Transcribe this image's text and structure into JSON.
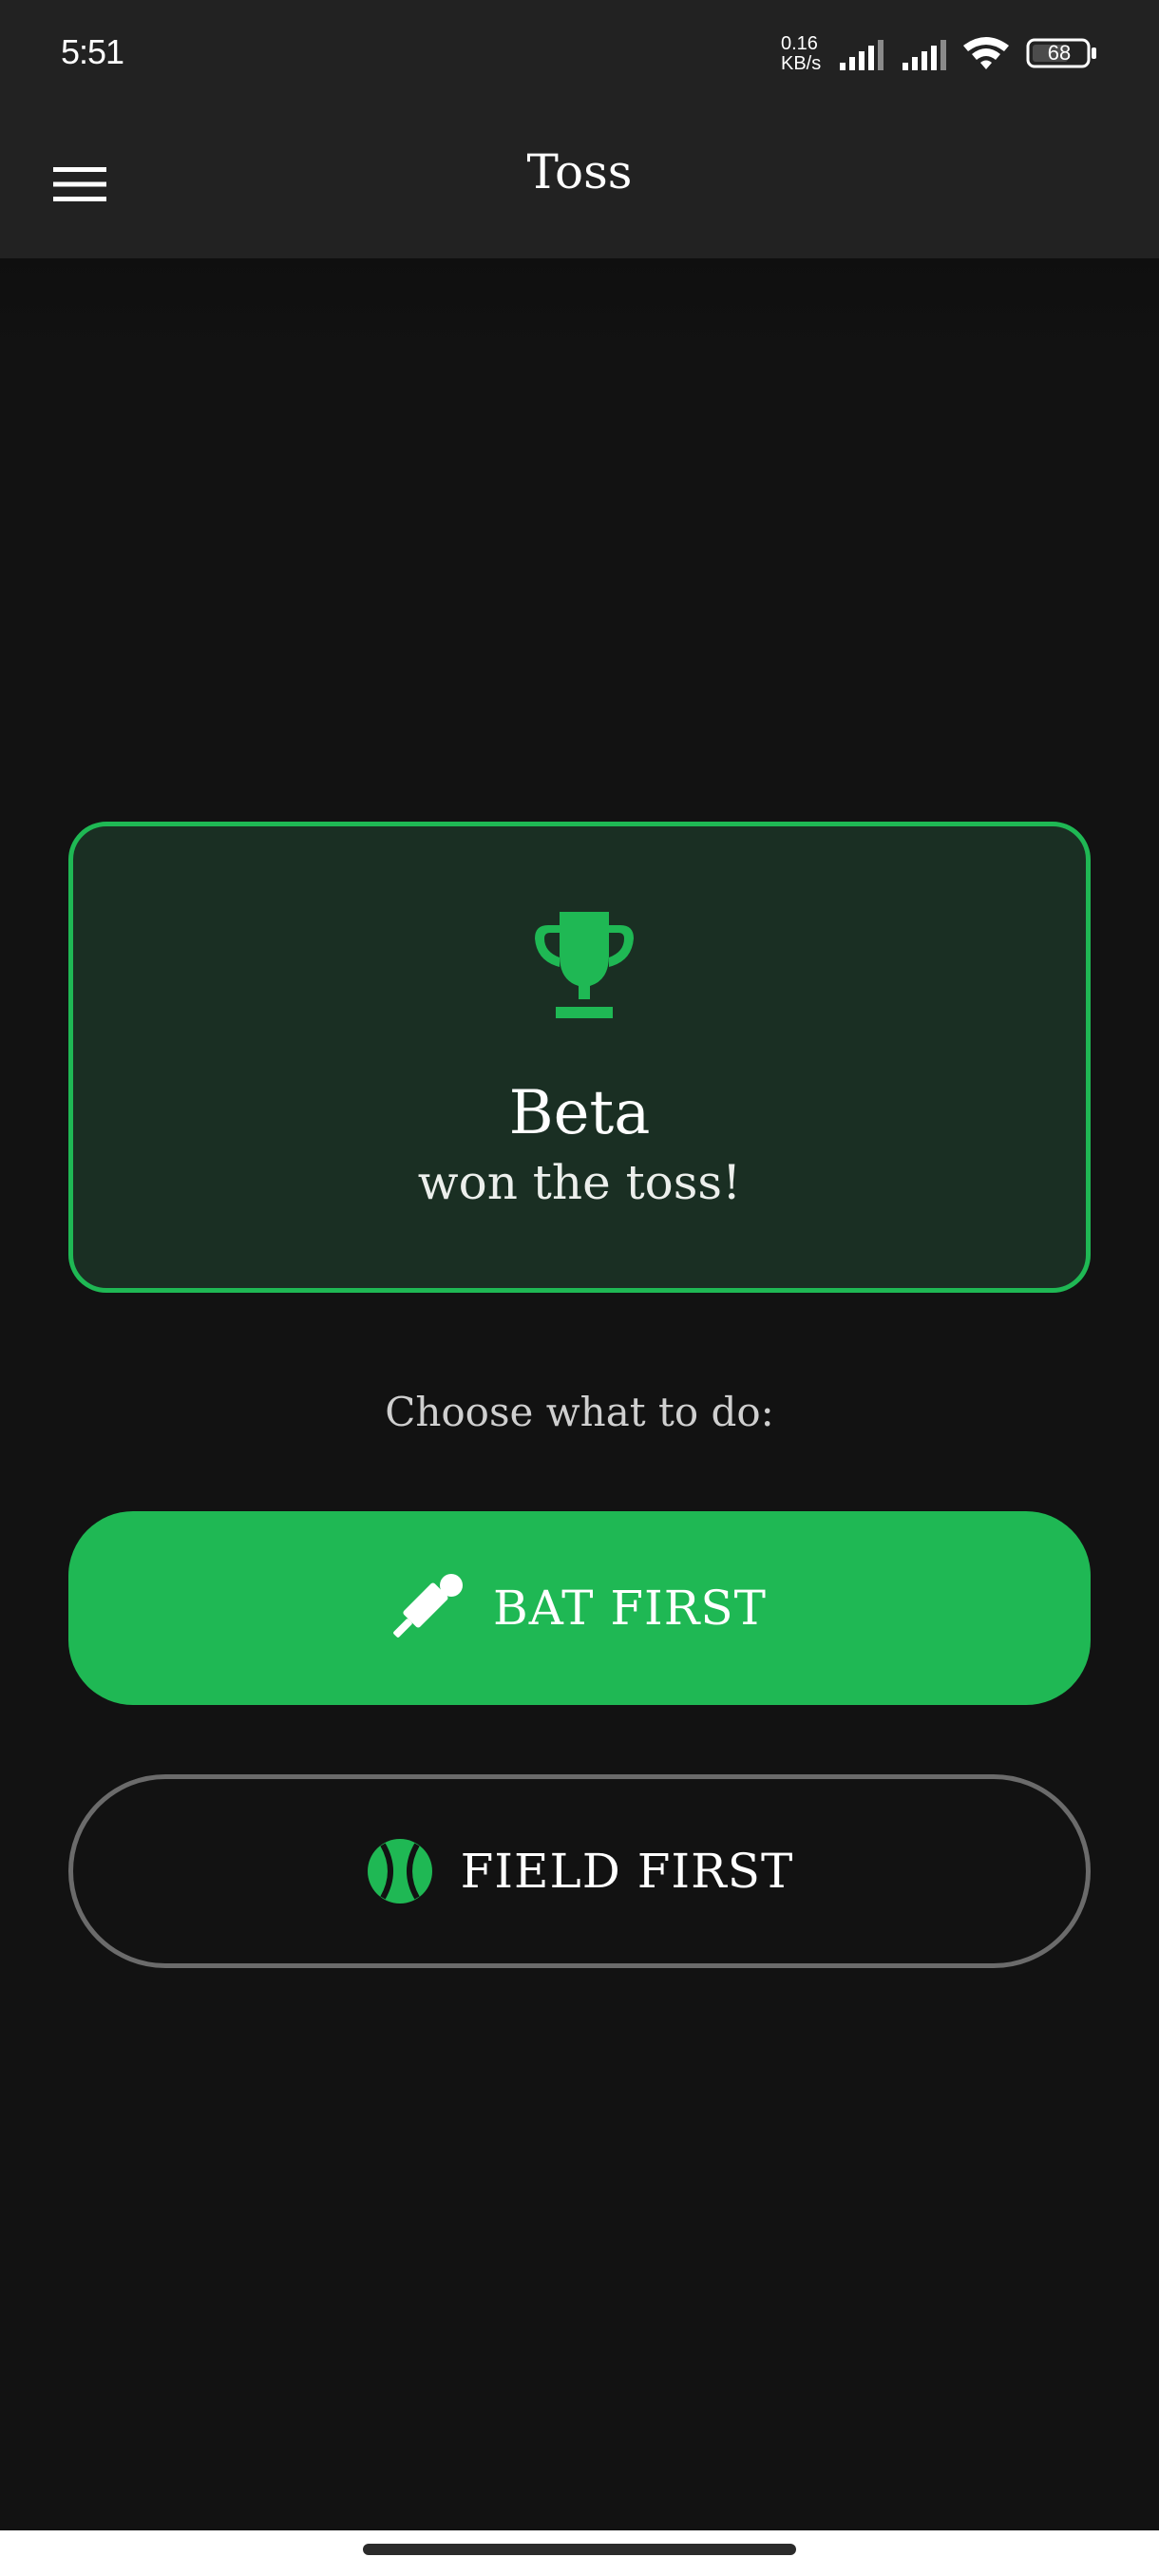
{
  "status_bar": {
    "time": "5:51",
    "network_speed_value": "0.16",
    "network_speed_unit": "KB/s",
    "battery_level": "68"
  },
  "app_bar": {
    "title": "Toss",
    "menu_icon": "hamburger-menu-icon"
  },
  "toss_result": {
    "icon": "trophy-icon",
    "winner": "Beta",
    "caption": "won the toss!"
  },
  "choice": {
    "prompt": "Choose what to do:",
    "bat_first_label": "BAT FIRST",
    "bat_first_icon": "cricket-bat-icon",
    "field_first_label": "FIELD FIRST",
    "field_first_icon": "cricket-ball-icon"
  },
  "colors": {
    "accent": "#1fb854",
    "background": "#121212",
    "app_bar": "#222222",
    "card_background": "#1a2f23",
    "outline": "#6b6b6b"
  }
}
